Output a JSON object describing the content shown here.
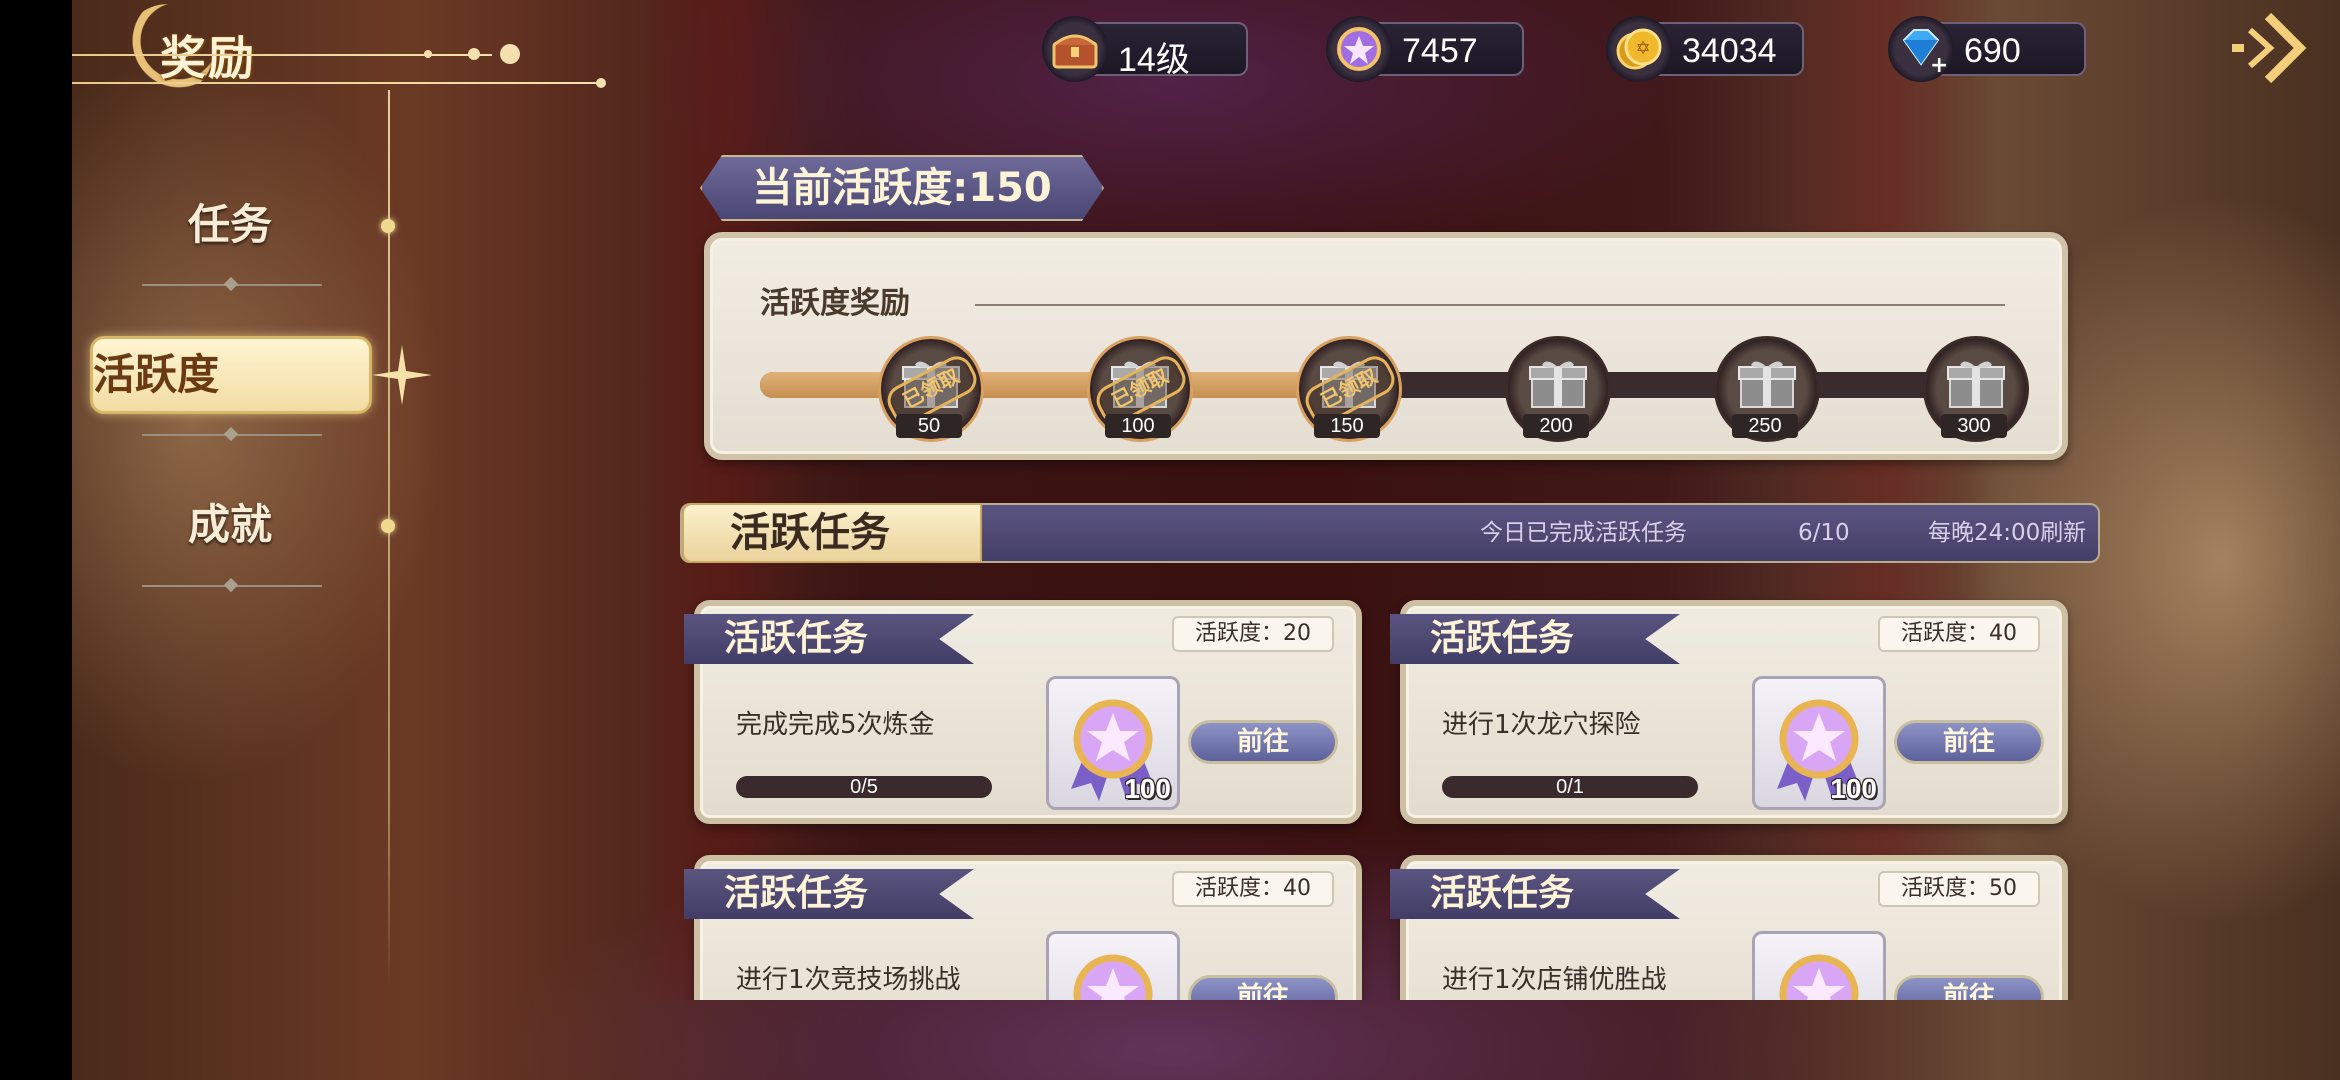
{
  "header": {
    "title": "奖励",
    "resources": [
      {
        "icon": "treasure-chest-icon",
        "value": "14级"
      },
      {
        "icon": "purple-star-medal-icon",
        "value": "7457"
      },
      {
        "icon": "gold-coin-icon",
        "value": "34034"
      },
      {
        "icon": "blue-diamond-icon",
        "value": "690"
      }
    ],
    "back_icon": "double-chevron-right-icon"
  },
  "nav": {
    "items": [
      {
        "label": "任务",
        "active": false
      },
      {
        "label": "活跃度",
        "active": true
      },
      {
        "label": "成就",
        "active": false
      }
    ]
  },
  "activity": {
    "current_label": "当前活跃度:150",
    "reward_title": "活跃度奖励",
    "progress_fraction": 0.5,
    "milestones": [
      {
        "value": "50",
        "claimed": true,
        "stamp": "已领取"
      },
      {
        "value": "100",
        "claimed": true,
        "stamp": "已领取"
      },
      {
        "value": "150",
        "claimed": true,
        "stamp": "已领取"
      },
      {
        "value": "200",
        "claimed": false,
        "stamp": ""
      },
      {
        "value": "250",
        "claimed": false,
        "stamp": ""
      },
      {
        "value": "300",
        "claimed": false,
        "stamp": ""
      }
    ]
  },
  "task_bar": {
    "title": "活跃任务",
    "completed_label": "今日已完成活跃任务",
    "completed_count": "6/10",
    "refresh_label": "每晚24:00刷新"
  },
  "tasks": [
    {
      "ribbon": "活跃任务",
      "points": "活跃度：20",
      "desc": "完成完成5次炼金",
      "progress": "0/5",
      "reward_count": "100",
      "button": "前往"
    },
    {
      "ribbon": "活跃任务",
      "points": "活跃度：40",
      "desc": "进行1次龙穴探险",
      "progress": "0/1",
      "reward_count": "100",
      "button": "前往"
    },
    {
      "ribbon": "活跃任务",
      "points": "活跃度：40",
      "desc": "进行1次竞技场挑战",
      "progress": "",
      "reward_count": "",
      "button": "前往"
    },
    {
      "ribbon": "活跃任务",
      "points": "活跃度：50",
      "desc": "进行1次店铺优胜战",
      "progress": "",
      "reward_count": "",
      "button": "前往"
    }
  ],
  "colors": {
    "accent_gold": "#e1b27a",
    "panel_purple": "#4b4774",
    "panel_cream": "#f1ece2"
  }
}
